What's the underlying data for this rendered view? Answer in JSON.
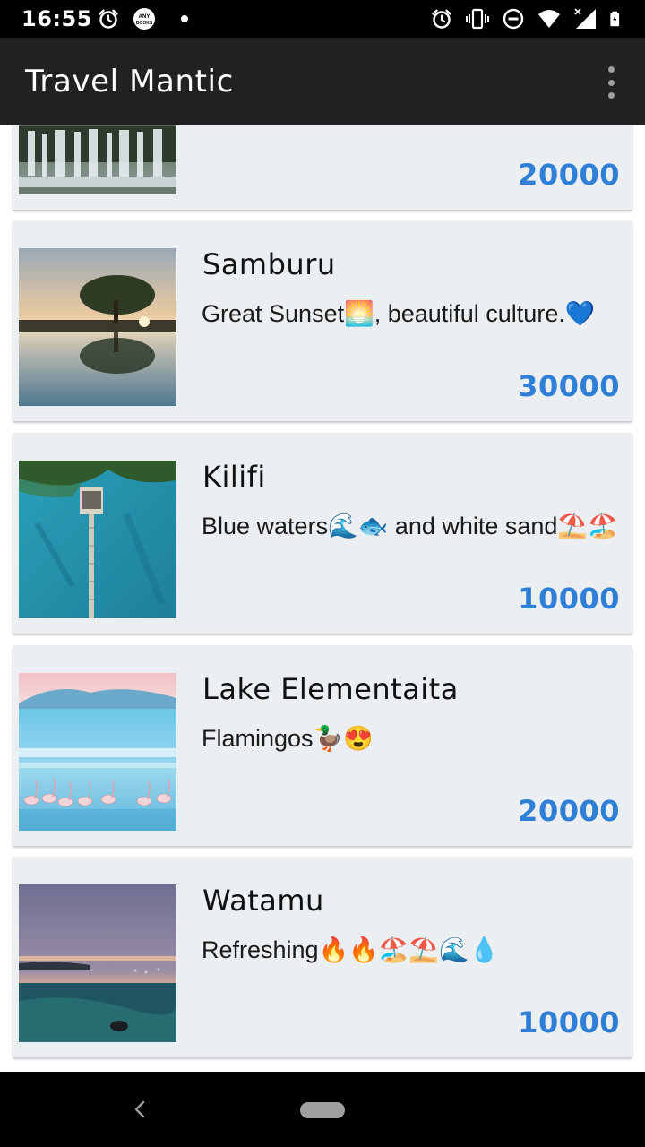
{
  "status_bar": {
    "time": "16:55",
    "left_icons": [
      "alarm-icon",
      "any-books-app-icon",
      "notification-dot-icon"
    ],
    "right_icons": [
      "alarm-icon",
      "vibrate-icon",
      "do-not-disturb-icon",
      "wifi-icon",
      "signal-icon",
      "battery-icon"
    ],
    "badge_text": "ANY BOOKS"
  },
  "app_bar": {
    "title": "Travel Mantic",
    "menu_icon": "more-vert-icon"
  },
  "destinations": [
    {
      "name": "",
      "description": "",
      "price": "20000",
      "image": "waterfall-image"
    },
    {
      "name": "Samburu",
      "description": "Great Sunset🌅, beautiful culture.💙",
      "price": "30000",
      "image": "tree-reflection-image"
    },
    {
      "name": "Kilifi",
      "description": "Blue waters🌊🐟 and white sand⛱️🏖️",
      "price": "10000",
      "image": "pier-aerial-image"
    },
    {
      "name": "Lake Elementaita",
      "description": "Flamingos🦆😍",
      "price": "20000",
      "image": "flamingos-lake-image"
    },
    {
      "name": "Watamu",
      "description": "Refreshing🔥🔥🏖️⛱️🌊💧",
      "price": "10000",
      "image": "sunset-sea-image"
    }
  ],
  "nav_bar": {
    "icons": [
      "back-icon",
      "home-pill-icon"
    ]
  },
  "colors": {
    "status_bar": "#000000",
    "app_bar": "#212121",
    "card_background": "#eceff1",
    "price_accent": "#2f7fd6",
    "nav_bar": "#000000"
  }
}
